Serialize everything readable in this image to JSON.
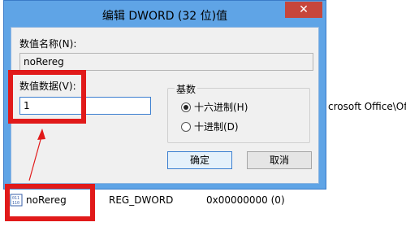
{
  "dialog": {
    "title": "编辑 DWORD (32 位)值",
    "close_label": "✕",
    "value_name_label": "数值名称(N):",
    "value_name": "noRereg",
    "value_data_label": "数值数据(V):",
    "value_data": "1",
    "base_group_label": "基数",
    "base_options": [
      {
        "label": "十六进制(H)",
        "checked": true
      },
      {
        "label": "十进制(D)",
        "checked": false
      }
    ],
    "ok_label": "确定",
    "cancel_label": "取消"
  },
  "background": {
    "side_text": "crosoft Office\\Of",
    "row": {
      "name": "noRereg",
      "type": "REG_DWORD",
      "data": "0x00000000 (0)"
    }
  },
  "colors": {
    "titlebar": "#5fa4e6",
    "highlight": "#e11a1a",
    "close_button": "#c7463b"
  }
}
